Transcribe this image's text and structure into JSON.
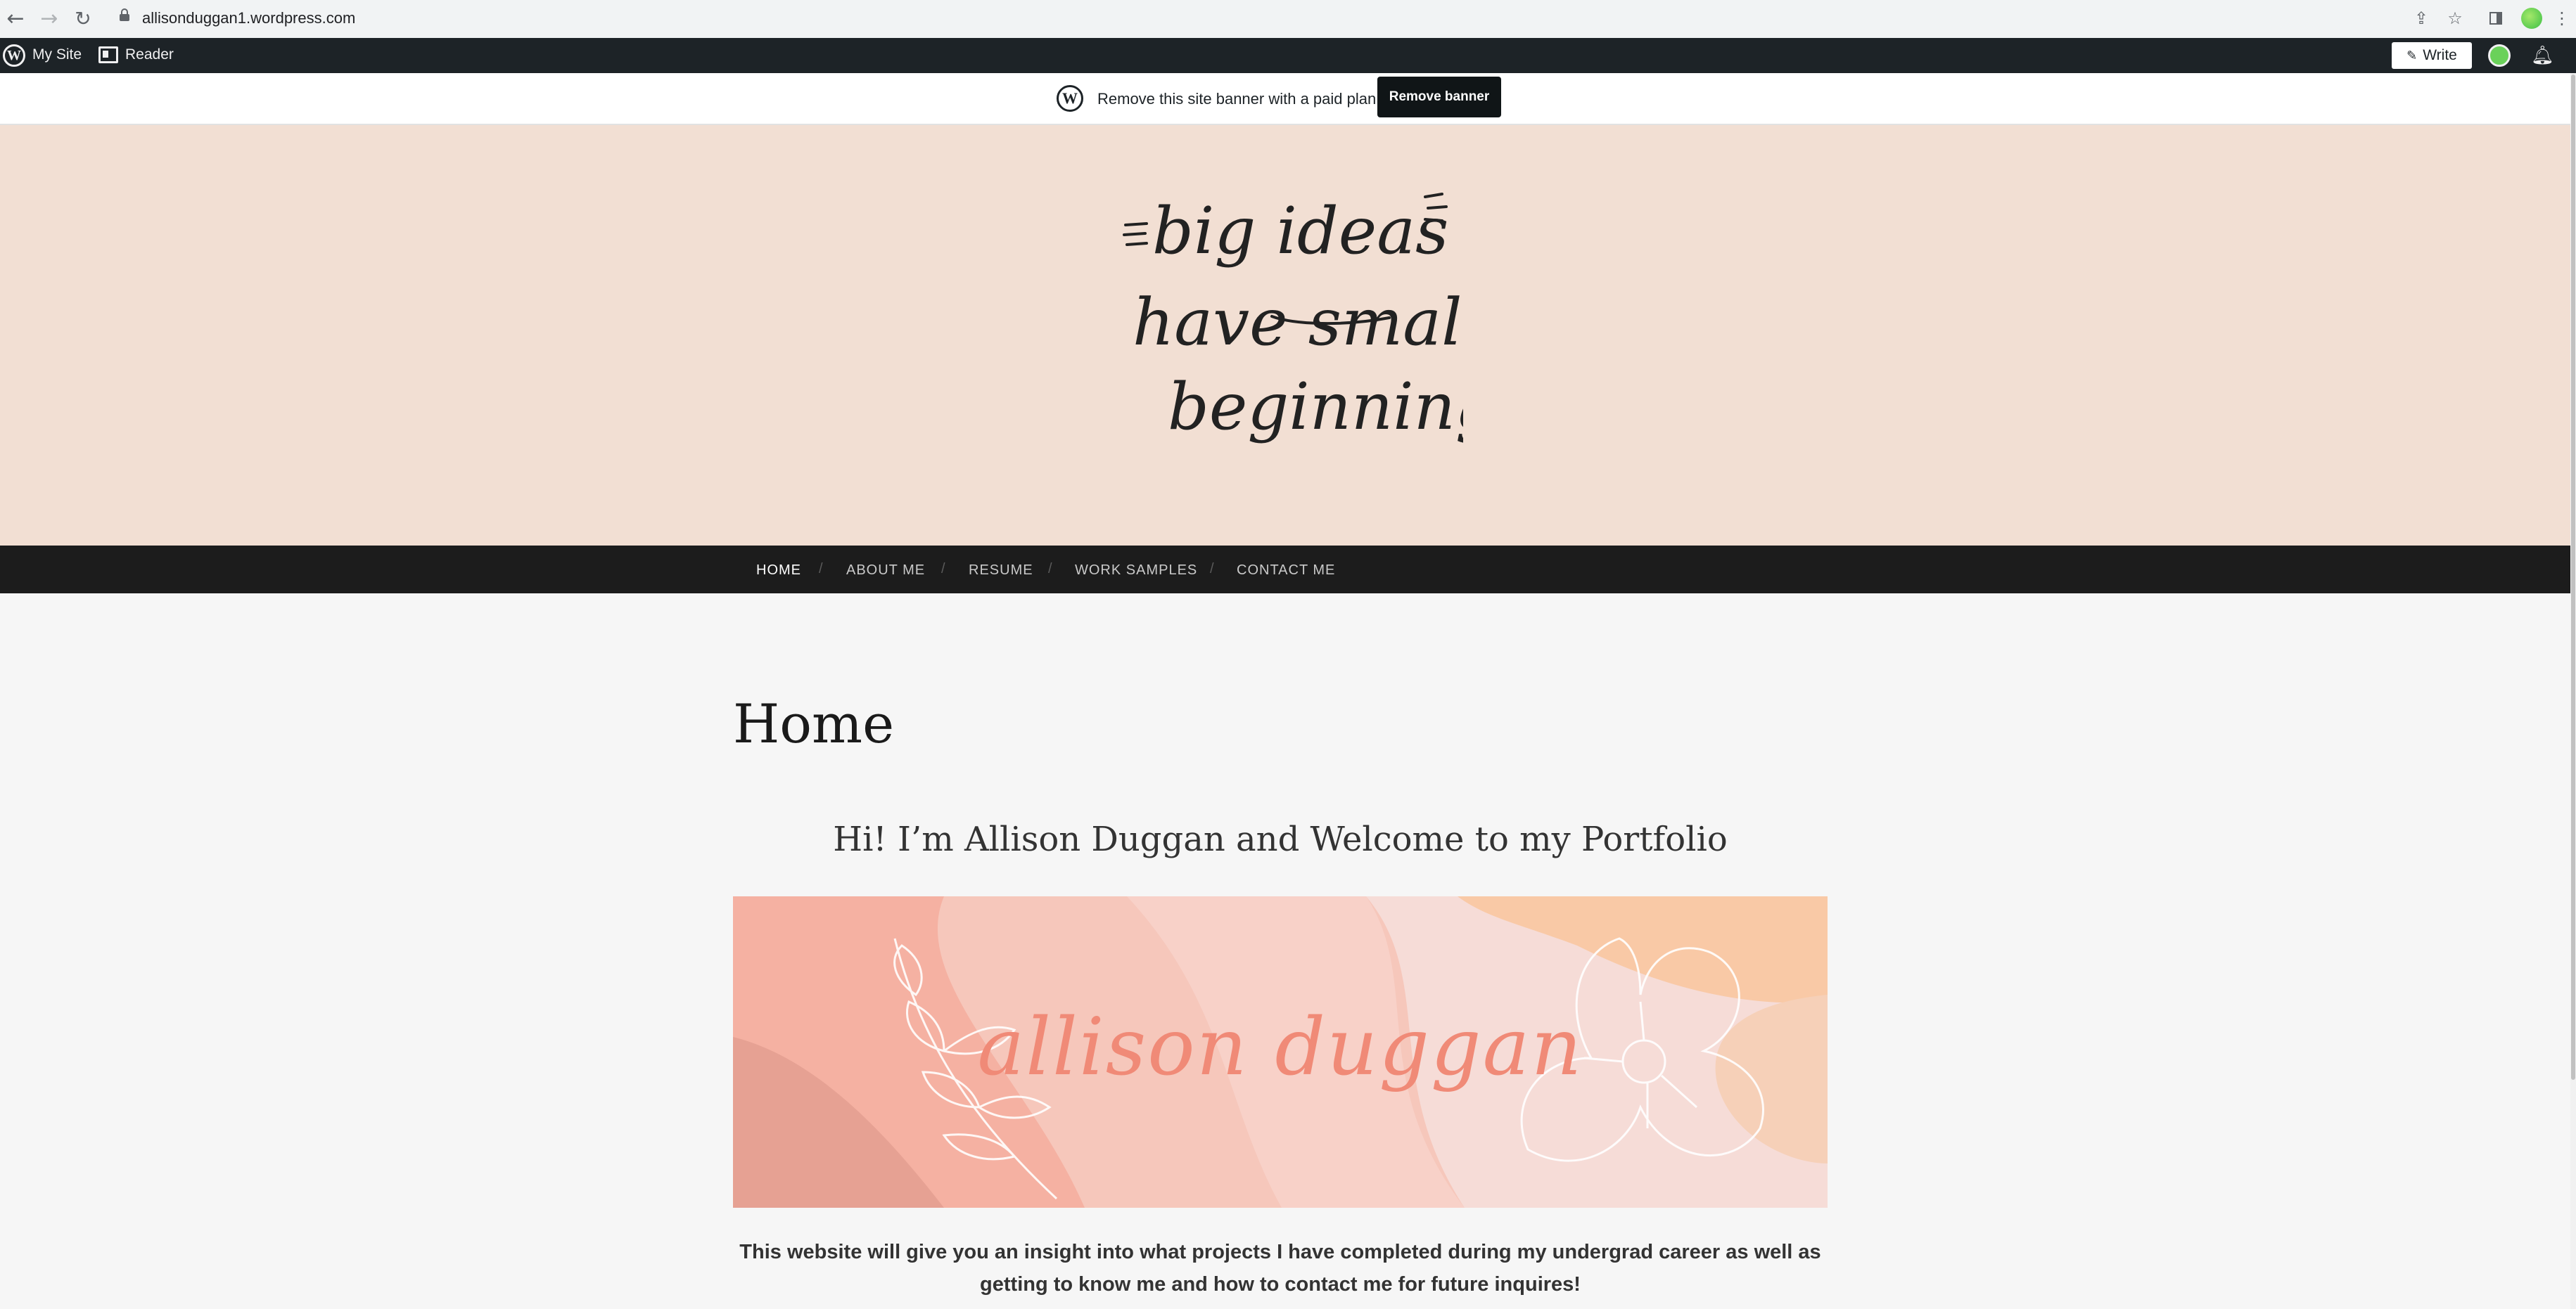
{
  "browser": {
    "url": "allisonduggan1.wordpress.com",
    "icons": [
      "back-icon",
      "forward-icon",
      "reload-icon",
      "lock-icon",
      "share-icon",
      "star-icon",
      "side-panel-icon",
      "profile-avatar",
      "menu-icon"
    ]
  },
  "adminbar": {
    "my_site": "My Site",
    "reader": "Reader",
    "write": "Write"
  },
  "banner": {
    "text": "Remove this site banner with a paid plan",
    "button": "Remove banner"
  },
  "header": {
    "logo_text": [
      "big ideas",
      "have small",
      "beginnings"
    ]
  },
  "nav": {
    "items": [
      {
        "label": "HOME"
      },
      {
        "label": "ABOUT ME"
      },
      {
        "label": "RESUME"
      },
      {
        "label": "WORK SAMPLES"
      },
      {
        "label": "CONTACT ME"
      }
    ]
  },
  "page": {
    "title": "Home",
    "welcome": "Hi! I’m Allison Duggan and Welcome to my Portfolio",
    "hero_name": "allison duggan",
    "intro": "This website will give you an insight into what projects I have completed during my undergrad career as well as getting to know me and how to contact me for future inquires!"
  },
  "colors": {
    "header_bg": "#f2dfd3",
    "nav_bg": "#1c1c1c",
    "adminbar_bg": "#1d2327",
    "hero_accent": "#f08a77"
  }
}
